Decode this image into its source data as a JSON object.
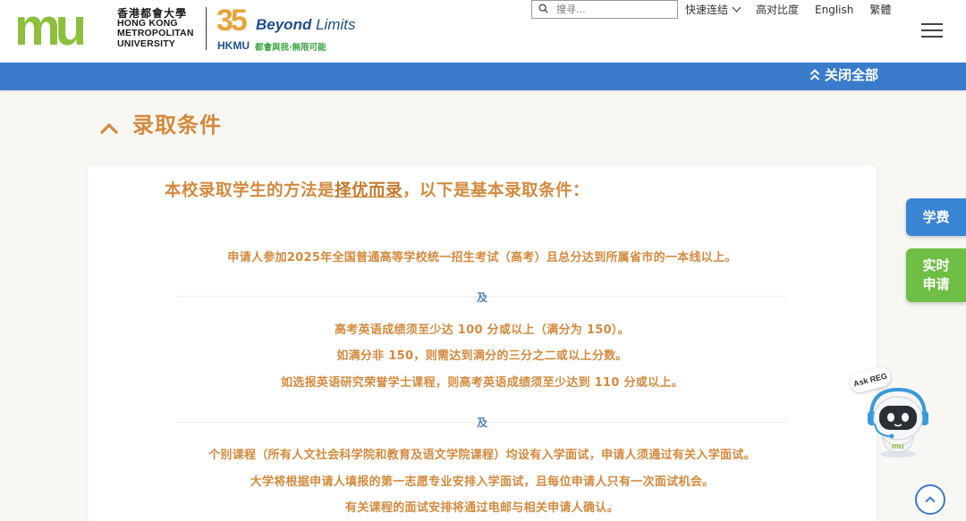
{
  "header": {
    "logo_mark": "mu",
    "logo_text": {
      "zh": "香港都會大學",
      "en1": "HONG KONG",
      "en2": "METROPOLITAN",
      "en3": "UNIVERSITY"
    },
    "anniversary": {
      "number": "35",
      "beyond": "Beyond",
      "limits": "Limits",
      "hkmu": "HKMU",
      "slogan": "都會與我·無限可能"
    },
    "search": {
      "placeholder": "搜寻..."
    },
    "links": {
      "quick_links": "快速连结",
      "high_contrast": "高对比度",
      "english": "English",
      "traditional": "繁體"
    }
  },
  "toolbar": {
    "collapse_all": "关闭全部"
  },
  "section": {
    "title": "录取条件",
    "intro_prefix": "本校录取学生的方法是",
    "intro_emph": "择优而录",
    "intro_suffix": "，以下是基本录取条件：",
    "req1": "申请人参加2025年全国普通高等学校统一招生考试（高考）且总分达到所属省市的一本线以上。",
    "and1": "及",
    "req2_line1": "高考英语成绩须至少达 100 分或以上（满分为 150）。",
    "req2_line2": "如满分非 150，则需达到满分的三分之二或以上分数。",
    "req2_line3": "如选报英语研究荣誉学士课程，则高考英语成绩须至少达到 110 分或以上。",
    "and2": "及",
    "req3_line1": "个别课程（所有人文社会科学院和教育及语文学院课程）均设有入学面试，申请人须通过有关入学面试。",
    "req3_line2": "大学将根据申请人填报的第一志愿专业安排入学面试，且每位申请人只有一次面试机会。",
    "req3_line3": "有关课程的面试安排将通过电邮与相关申请人确认。"
  },
  "side": {
    "fee": "学费",
    "apply_line1": "实时",
    "apply_line2": "申请"
  },
  "chatbot": {
    "label": "Ask REG",
    "face_logo": "mu"
  },
  "colors": {
    "accent_orange": "#d48a3e",
    "brand_blue": "#3a7ccb",
    "fee_blue": "#3a84d4",
    "apply_green": "#6fbf46"
  }
}
